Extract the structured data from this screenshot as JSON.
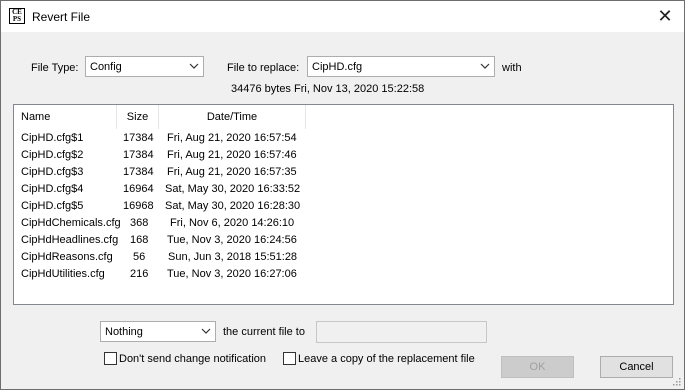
{
  "window": {
    "title": "Revert File",
    "icon_text": "CE PS",
    "close_icon": "close-icon"
  },
  "file_type": {
    "label": "File Type:",
    "value": "Config"
  },
  "file_replace": {
    "label": "File to replace:",
    "value": "CipHD.cfg",
    "with_label": "with"
  },
  "current_info": "34476 bytes Fri, Nov 13, 2020 15:22:58",
  "list": {
    "columns": [
      "Name",
      "Size",
      "Date/Time"
    ],
    "rows": [
      {
        "name": "CipHD.cfg$1",
        "size": "17384",
        "date": "Fri, Aug 21, 2020 16:57:54"
      },
      {
        "name": "CipHD.cfg$2",
        "size": "17384",
        "date": "Fri, Aug 21, 2020 16:57:46"
      },
      {
        "name": "CipHD.cfg$3",
        "size": "17384",
        "date": "Fri, Aug 21, 2020 16:57:35"
      },
      {
        "name": "CipHD.cfg$4",
        "size": "16964",
        "date": "Sat, May 30, 2020 16:33:52"
      },
      {
        "name": "CipHD.cfg$5",
        "size": "16968",
        "date": "Sat, May 30, 2020 16:28:30"
      },
      {
        "name": "CipHdChemicals.cfg",
        "size": "368",
        "date": "Fri, Nov 6, 2020 14:26:10"
      },
      {
        "name": "CipHdHeadlines.cfg",
        "size": "168",
        "date": "Tue, Nov 3, 2020 16:24:56"
      },
      {
        "name": "CipHdReasons.cfg",
        "size": "56",
        "date": "Sun, Jun 3, 2018 15:51:28"
      },
      {
        "name": "CipHdUtilities.cfg",
        "size": "216",
        "date": "Tue, Nov 3, 2020 16:27:06"
      }
    ]
  },
  "action": {
    "value": "Nothing",
    "label": "the current file to",
    "textbox_value": ""
  },
  "options": {
    "no_notify": {
      "label": "Don't send change notification",
      "checked": false
    },
    "leave_copy": {
      "label": "Leave a copy of the replacement file",
      "checked": false
    }
  },
  "buttons": {
    "ok": "OK",
    "cancel": "Cancel"
  }
}
